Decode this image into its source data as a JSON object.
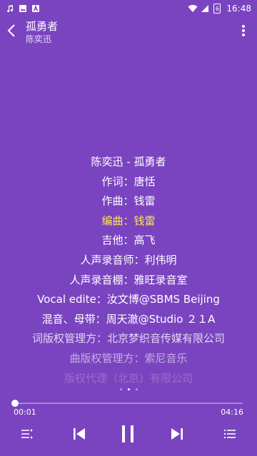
{
  "status_bar": {
    "time": "16:48",
    "battery_level": "6",
    "left_icons": [
      "music-note-icon",
      "image-icon",
      "a-icon"
    ],
    "right_icons": [
      "wifi-icon",
      "signal-icon",
      "battery-icon"
    ]
  },
  "header": {
    "title": "孤勇者",
    "subtitle": "陈奕迅",
    "back_icon": "back-chevron-icon",
    "more_icon": "more-vertical-icon"
  },
  "lyrics": {
    "active_index": 3,
    "lines": [
      "陈奕迅 - 孤勇者",
      "作词：唐恬",
      "作曲：钱雷",
      "编曲：钱雷",
      "吉他：高飞",
      "人声录音师：利伟明",
      "人声录音棚：雅旺录音室",
      "Vocal edite：汝文博@SBMS Beijing",
      "混音、母带：周天澈@Studio ２１A",
      "词版权管理方：北京梦织音传媒有限公司",
      "曲版权管理方：索尼音乐",
      "版权代理（北京）有限公司"
    ],
    "active_color": "#ffe84a"
  },
  "pager": {
    "count": 3,
    "active": 1
  },
  "player": {
    "current_time": "00:01",
    "total_time": "04:16",
    "progress": 0.004,
    "controls": [
      "playlist-mode-icon",
      "previous-icon",
      "pause-icon",
      "next-icon",
      "queue-list-icon"
    ]
  },
  "colors": {
    "background": "#7a44c0",
    "text": "#ffffff"
  }
}
